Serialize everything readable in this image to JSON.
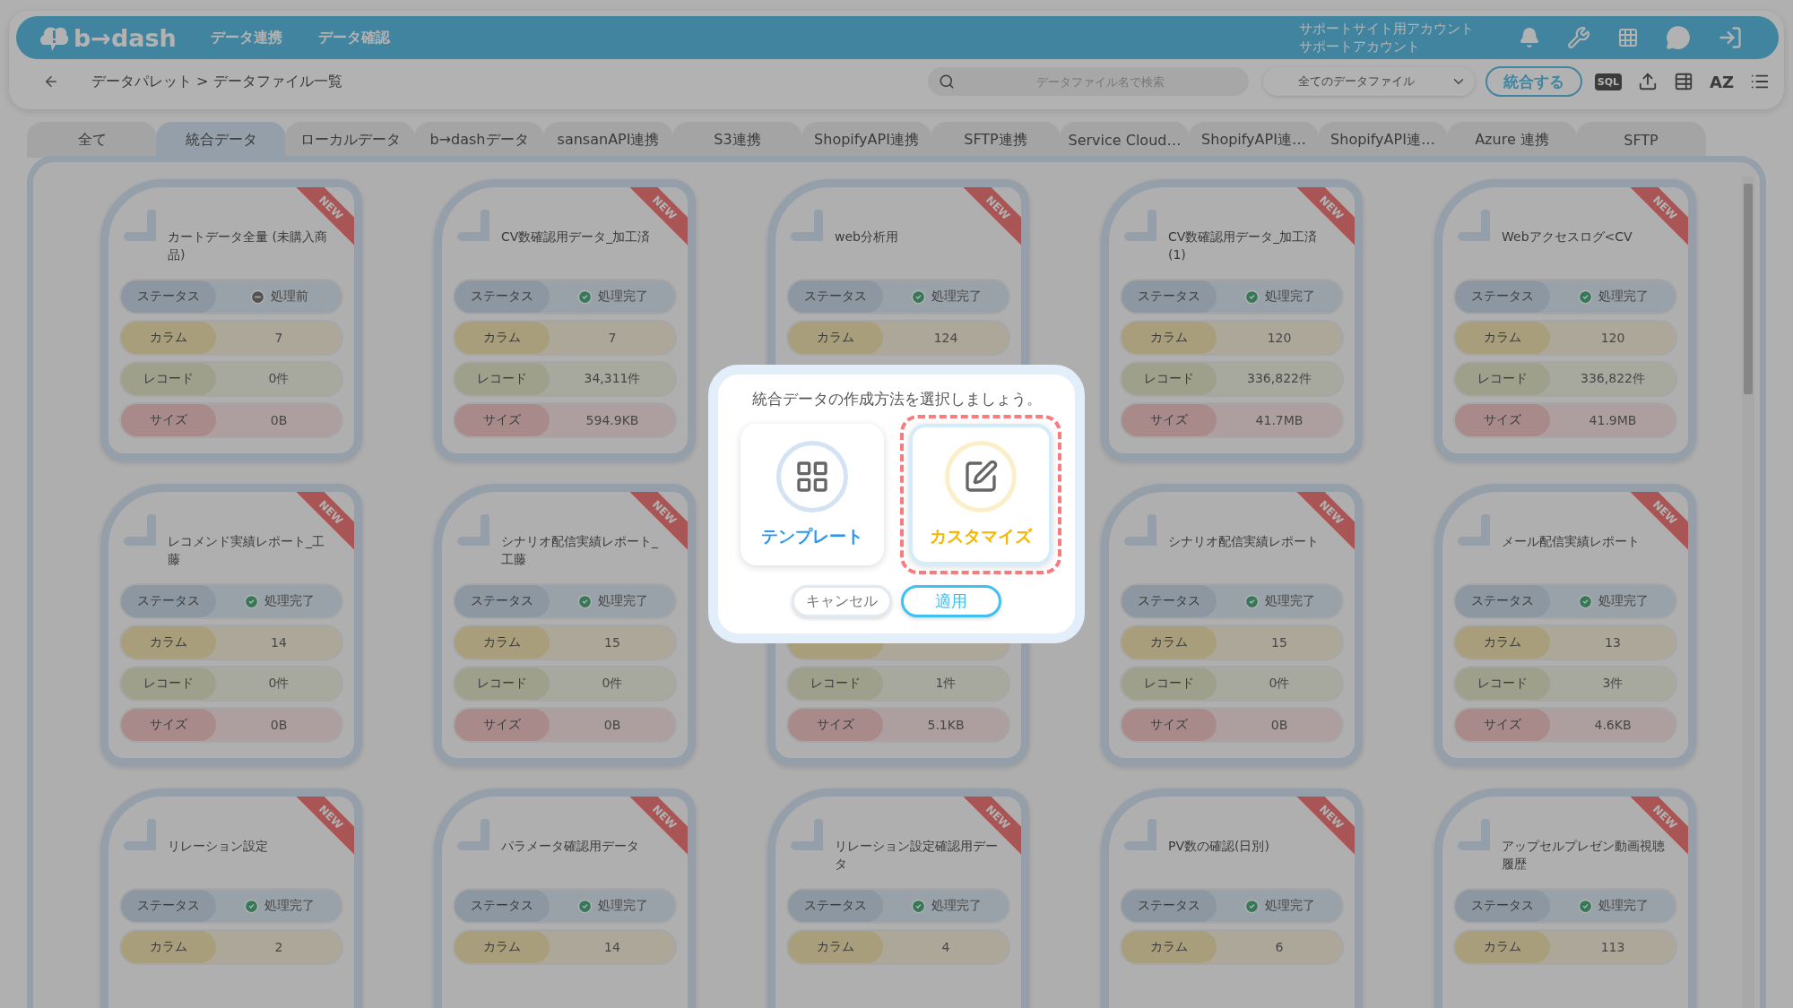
{
  "header": {
    "logo": "b→dash",
    "nav": [
      "データ連携",
      "データ確認"
    ],
    "account": [
      "サポートサイト用アカウント",
      "サポートアカウント"
    ]
  },
  "toolbar": {
    "breadcrumb": "データパレット > データファイル一覧",
    "search": {
      "placeholder": "データファイル名で検索"
    },
    "filter": "全てのデータファイル",
    "merge_button": "統合する",
    "sql": "SQL",
    "sort": "AZ"
  },
  "tabs": [
    {
      "label": "全て",
      "selected": false
    },
    {
      "label": "統合データ",
      "selected": true
    },
    {
      "label": "ローカルデータ",
      "selected": false
    },
    {
      "label": "b→dashデータ",
      "selected": false
    },
    {
      "label": "sansanAPI連携",
      "selected": false
    },
    {
      "label": "S3連携",
      "selected": false
    },
    {
      "label": "ShopifyAPI連携",
      "selected": false
    },
    {
      "label": "SFTP連携",
      "selected": false
    },
    {
      "label": "Service Cloud…",
      "selected": false
    },
    {
      "label": "ShopifyAPI連…",
      "selected": false
    },
    {
      "label": "ShopifyAPI連…",
      "selected": false
    },
    {
      "label": "Azure 連携",
      "selected": false
    },
    {
      "label": "SFTP",
      "selected": false
    }
  ],
  "cards": [
    {
      "title": "カートデータ全量 (未購入商品)",
      "badge": "NEW",
      "rows": [
        {
          "kind": "status",
          "label": "ステータス",
          "value": "処理前",
          "complete": false
        },
        {
          "kind": "columns",
          "label": "カラム",
          "value": "7"
        },
        {
          "kind": "records",
          "label": "レコード",
          "value": "0件"
        },
        {
          "kind": "size",
          "label": "サイズ",
          "value": "0B"
        }
      ]
    },
    {
      "title": "CV数確認用データ_加工済",
      "badge": "NEW",
      "rows": [
        {
          "kind": "status",
          "label": "ステータス",
          "value": "処理完了",
          "complete": true
        },
        {
          "kind": "columns",
          "label": "カラム",
          "value": "7"
        },
        {
          "kind": "records",
          "label": "レコード",
          "value": "34,311件"
        },
        {
          "kind": "size",
          "label": "サイズ",
          "value": "594.9KB"
        }
      ]
    },
    {
      "title": "web分析用",
      "badge": "NEW",
      "rows": [
        {
          "kind": "status",
          "label": "ステータス",
          "value": "処理完了",
          "complete": true
        },
        {
          "kind": "columns",
          "label": "カラム",
          "value": "124"
        }
      ]
    },
    {
      "title": "CV数確認用データ_加工済(1)",
      "badge": "NEW",
      "rows": [
        {
          "kind": "status",
          "label": "ステータス",
          "value": "処理完了",
          "complete": true
        },
        {
          "kind": "columns",
          "label": "カラム",
          "value": "120"
        },
        {
          "kind": "records",
          "label": "レコード",
          "value": "336,822件"
        },
        {
          "kind": "size",
          "label": "サイズ",
          "value": "41.7MB"
        }
      ]
    },
    {
      "title": "Webアクセスログ<CV",
      "badge": "NEW",
      "rows": [
        {
          "kind": "status",
          "label": "ステータス",
          "value": "処理完了",
          "complete": true
        },
        {
          "kind": "columns",
          "label": "カラム",
          "value": "120"
        },
        {
          "kind": "records",
          "label": "レコード",
          "value": "336,822件"
        },
        {
          "kind": "size",
          "label": "サイズ",
          "value": "41.9MB"
        }
      ]
    },
    {
      "title": "レコメンド実績レポート_工藤",
      "badge": "NEW",
      "rows": [
        {
          "kind": "status",
          "label": "ステータス",
          "value": "処理完了",
          "complete": true
        },
        {
          "kind": "columns",
          "label": "カラム",
          "value": "14"
        },
        {
          "kind": "records",
          "label": "レコード",
          "value": "0件"
        },
        {
          "kind": "size",
          "label": "サイズ",
          "value": "0B"
        }
      ]
    },
    {
      "title": "シナリオ配信実績レポート_工藤",
      "badge": "NEW",
      "rows": [
        {
          "kind": "status",
          "label": "ステータス",
          "value": "処理完了",
          "complete": true
        },
        {
          "kind": "columns",
          "label": "カラム",
          "value": "15"
        },
        {
          "kind": "records",
          "label": "レコード",
          "value": "0件"
        },
        {
          "kind": "size",
          "label": "サイズ",
          "value": "0B"
        }
      ]
    },
    {
      "rows": [
        {
          "kind": "columns"
        },
        {
          "kind": "records",
          "label": "レコード",
          "value": "1件"
        },
        {
          "kind": "size",
          "label": "サイズ",
          "value": "5.1KB"
        }
      ]
    },
    {
      "title": "シナリオ配信実績レポート",
      "badge": "NEW",
      "rows": [
        {
          "kind": "status",
          "label": "ステータス",
          "value": "処理完了",
          "complete": true
        },
        {
          "kind": "columns",
          "label": "カラム",
          "value": "15"
        },
        {
          "kind": "records",
          "label": "レコード",
          "value": "0件"
        },
        {
          "kind": "size",
          "label": "サイズ",
          "value": "0B"
        }
      ]
    },
    {
      "title": "メール配信実績レポート",
      "badge": "NEW",
      "rows": [
        {
          "kind": "status",
          "label": "ステータス",
          "value": "処理完了",
          "complete": true
        },
        {
          "kind": "columns",
          "label": "カラム",
          "value": "13"
        },
        {
          "kind": "records",
          "label": "レコード",
          "value": "3件"
        },
        {
          "kind": "size",
          "label": "サイズ",
          "value": "4.6KB"
        }
      ]
    },
    {
      "title": "リレーション設定",
      "badge": "NEW",
      "rows": [
        {
          "kind": "status",
          "label": "ステータス",
          "value": "処理完了",
          "complete": true
        },
        {
          "kind": "columns",
          "label": "カラム",
          "value": "2"
        }
      ]
    },
    {
      "title": "パラメータ確認用データ",
      "badge": "NEW",
      "rows": [
        {
          "kind": "status",
          "label": "ステータス",
          "value": "処理完了",
          "complete": true
        },
        {
          "kind": "columns",
          "label": "カラム",
          "value": "14"
        }
      ]
    },
    {
      "title": "リレーション設定確認用データ",
      "badge": "NEW",
      "rows": [
        {
          "kind": "status",
          "label": "ステータス",
          "value": "処理完了",
          "complete": true
        },
        {
          "kind": "columns",
          "label": "カラム",
          "value": "4"
        }
      ]
    },
    {
      "title": "PV数の確認(日別)",
      "badge": "NEW",
      "rows": [
        {
          "kind": "status",
          "label": "ステータス",
          "value": "処理完了",
          "complete": true
        },
        {
          "kind": "columns",
          "label": "カラム",
          "value": "6"
        }
      ]
    },
    {
      "title": "アップセルプレゼン動画視聴履歴",
      "badge": "NEW",
      "rows": [
        {
          "kind": "status",
          "label": "ステータス",
          "value": "処理完了",
          "complete": true
        },
        {
          "kind": "columns",
          "label": "カラム",
          "value": "113"
        }
      ]
    }
  ],
  "modal": {
    "title": "統合データの作成方法を選択しましょう。",
    "options": [
      {
        "kind": "template",
        "label": "テンプレート",
        "selected": false
      },
      {
        "kind": "custom",
        "label": "カスタマイズ",
        "selected": true
      }
    ],
    "cancel": "キャンセル",
    "apply": "適用"
  }
}
